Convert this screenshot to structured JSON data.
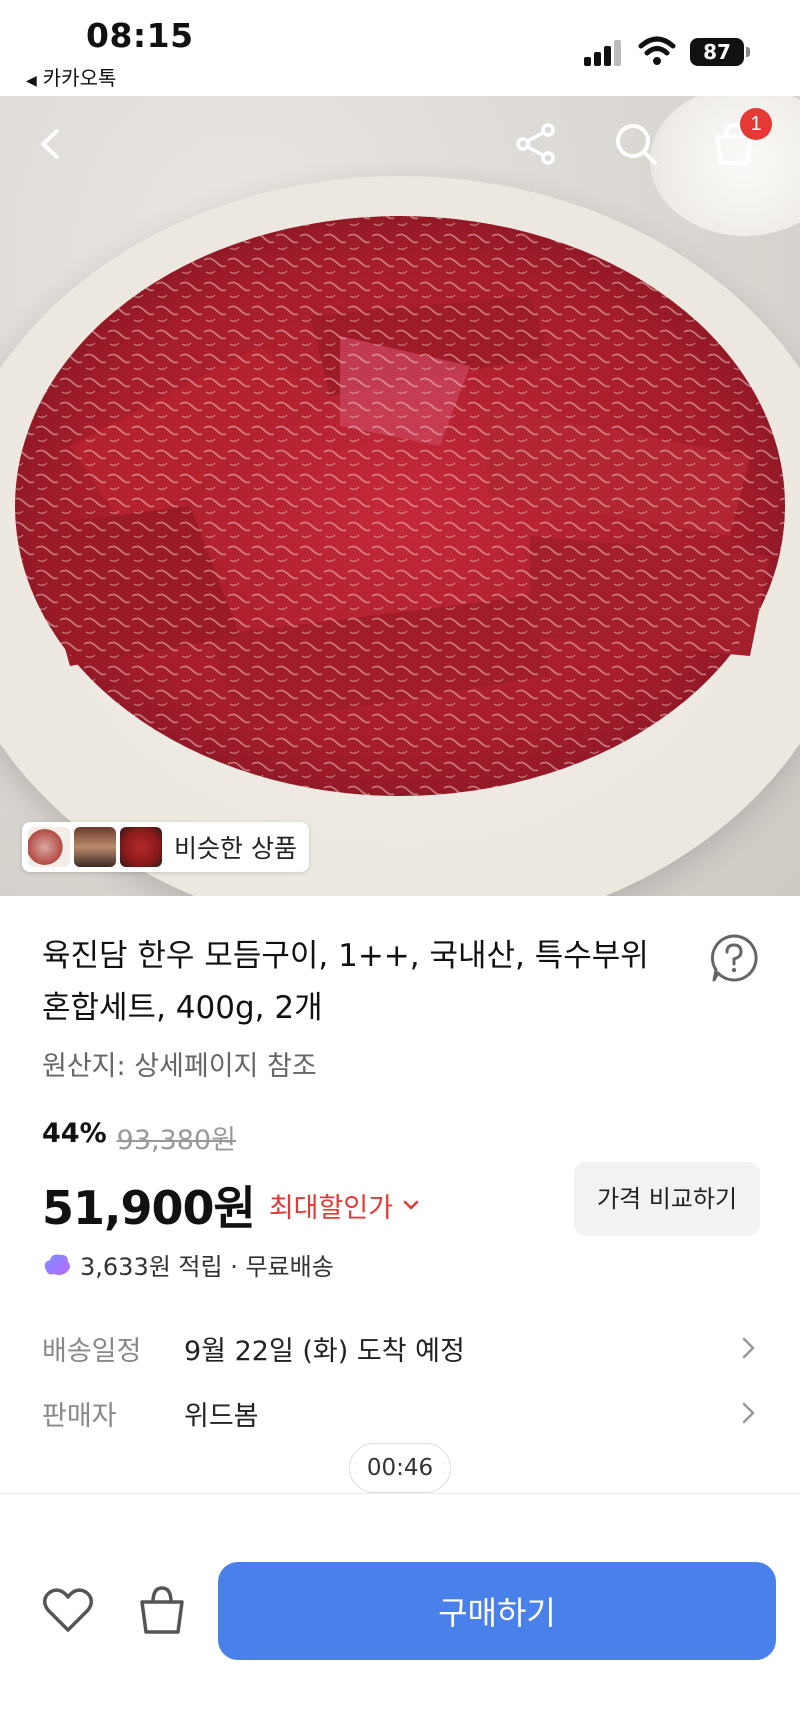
{
  "status_bar": {
    "time": "08:15",
    "back_app": "카카오톡",
    "battery": "87"
  },
  "hero": {
    "icons": [
      "back-arrow-icon",
      "share-icon",
      "search-icon",
      "cart-icon"
    ],
    "cart_badge": "1",
    "similar_label": "비슷한 상품"
  },
  "product": {
    "title": "육진담 한우 모듬구이, 1++, 국내산, 특수부위 혼합세트, 400g, 2개",
    "origin": "원산지: 상세페이지 참조",
    "discount_rate": "44%",
    "original_price": "93,380원",
    "sale_price": "51,900원",
    "max_discount_label": "최대할인가",
    "compare_button": "가격 비교하기",
    "benefit": "3,633원 적립 · 무료배송"
  },
  "info_rows": [
    {
      "label": "배송일정",
      "value": "9월 22일 (화) 도착 예정"
    },
    {
      "label": "판매자",
      "value": "위드봄"
    }
  ],
  "timer": "00:46",
  "bottom_bar": {
    "buy_button": "구매하기"
  },
  "colors": {
    "accent_red": "#e53935",
    "buy_blue": "#4a80ea"
  }
}
